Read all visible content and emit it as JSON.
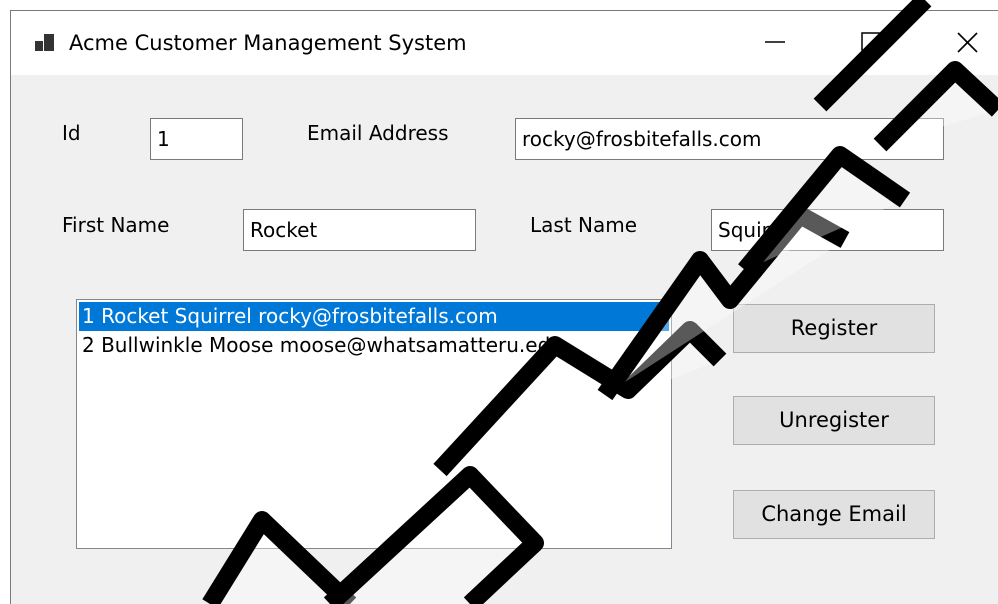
{
  "window": {
    "title": "Acme Customer Management System",
    "controls": {
      "minimize": "minimize-icon",
      "maximize": "maximize-icon",
      "close": "close-icon"
    }
  },
  "form": {
    "id_label": "Id",
    "id_value": "1",
    "email_label": "Email Address",
    "email_value": "rocky@frosbitefalls.com",
    "first_name_label": "First Name",
    "first_name_value": "Rocket",
    "last_name_label": "Last Name",
    "last_name_value": "Squirrel"
  },
  "customers": {
    "items": [
      {
        "text": "1 Rocket Squirrel rocky@frosbitefalls.com",
        "selected": true
      },
      {
        "text": "2 Bullwinkle Moose moose@whatsamatteru.edu",
        "selected": false
      }
    ]
  },
  "buttons": {
    "register": "Register",
    "unregister": "Unregister",
    "change_email": "Change Email"
  },
  "colors": {
    "selection": "#0078d7",
    "form_bg": "#f0f0f0",
    "button_bg": "#e1e1e1"
  }
}
